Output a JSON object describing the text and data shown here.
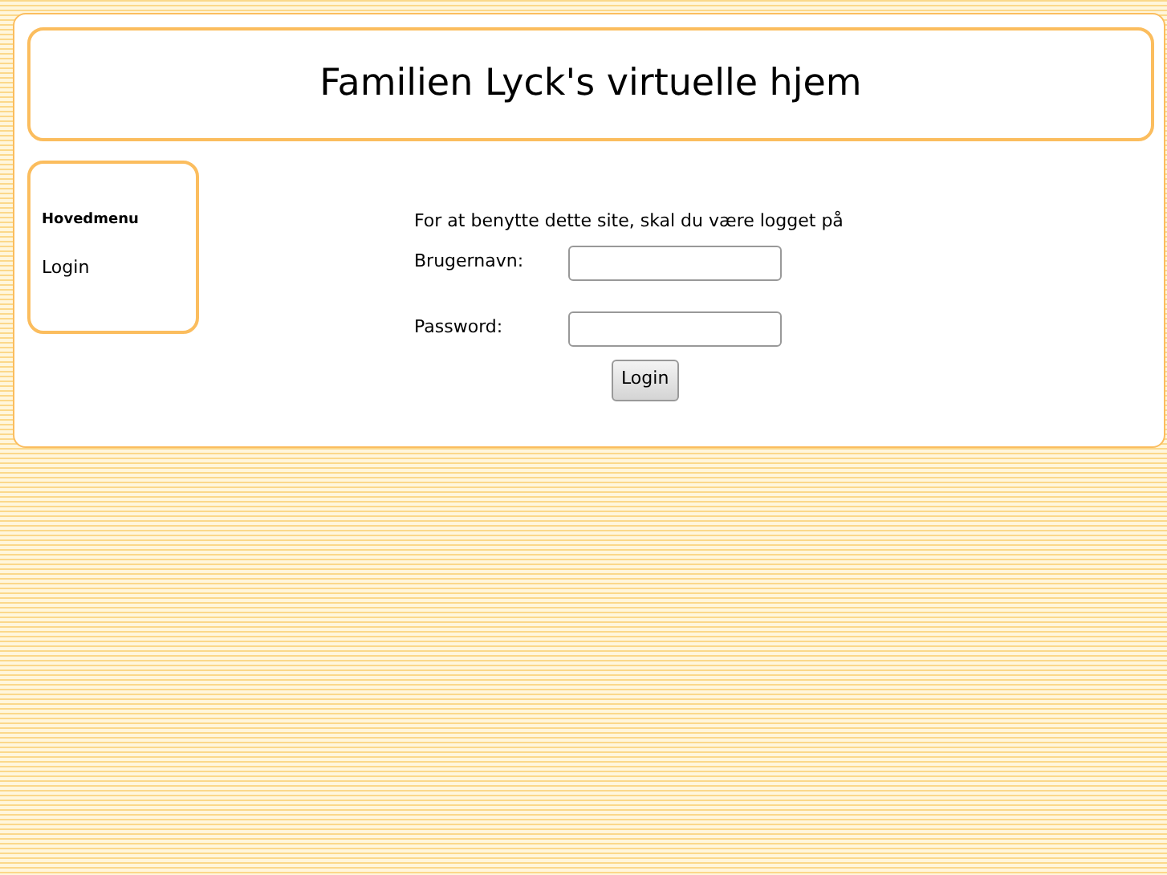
{
  "header": {
    "title": "Familien Lyck's virtuelle hjem"
  },
  "sidebar": {
    "heading": "Hovedmenu",
    "items": [
      {
        "label": "Login"
      }
    ]
  },
  "login": {
    "intro": "For at benytte dette site, skal du være logget på",
    "fields": [
      {
        "label": "Brugernavn:"
      },
      {
        "label": "Password:"
      }
    ],
    "button": "Login"
  }
}
